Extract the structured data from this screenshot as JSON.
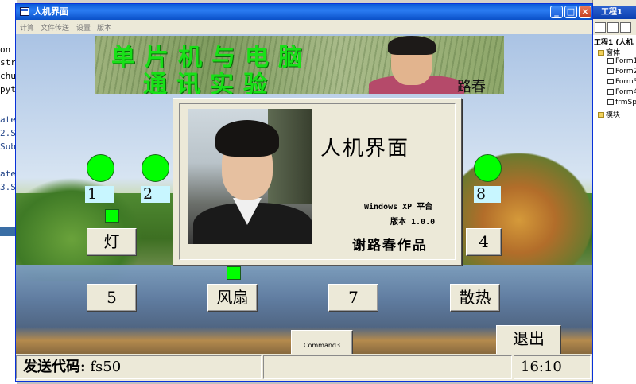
{
  "ide": {
    "left_code": [
      "on",
      "str",
      "chu",
      "pyt",
      "ate",
      "2.S",
      "Sub",
      "ate",
      "3.S"
    ],
    "right_title": "工程1",
    "tree": [
      "工程1 (人机",
      "窗体",
      "Form1",
      "Form2",
      "Form3",
      "Form4",
      "frmSp",
      "模块"
    ]
  },
  "window": {
    "title": "人机界面",
    "minimize": "_",
    "maximize": "□",
    "close": "×"
  },
  "menu": [
    "计算",
    "文件传送",
    "设置",
    "版本"
  ],
  "banner": {
    "line1": "单片机与电脑",
    "line2": "通讯实验",
    "signature": "路春"
  },
  "labels": [
    "1",
    "2",
    "8"
  ],
  "buttons": {
    "light": "灯",
    "four": "4",
    "five": "5",
    "fan": "风扇",
    "seven": "7",
    "cooling": "散热",
    "command3": "Command3",
    "exit": "退出"
  },
  "status": {
    "send_label": "发送代码:",
    "send_value": "fs50",
    "time": "16:10"
  },
  "splash": {
    "title": "人机界面",
    "platform": "Windows XP 平台",
    "version": "版本 1.0.0",
    "author": "谢路春作品"
  },
  "colors": {
    "indicator": "#00ff00",
    "label_bg": "#c8f6ff",
    "titlebar": "#0a5ad8"
  }
}
